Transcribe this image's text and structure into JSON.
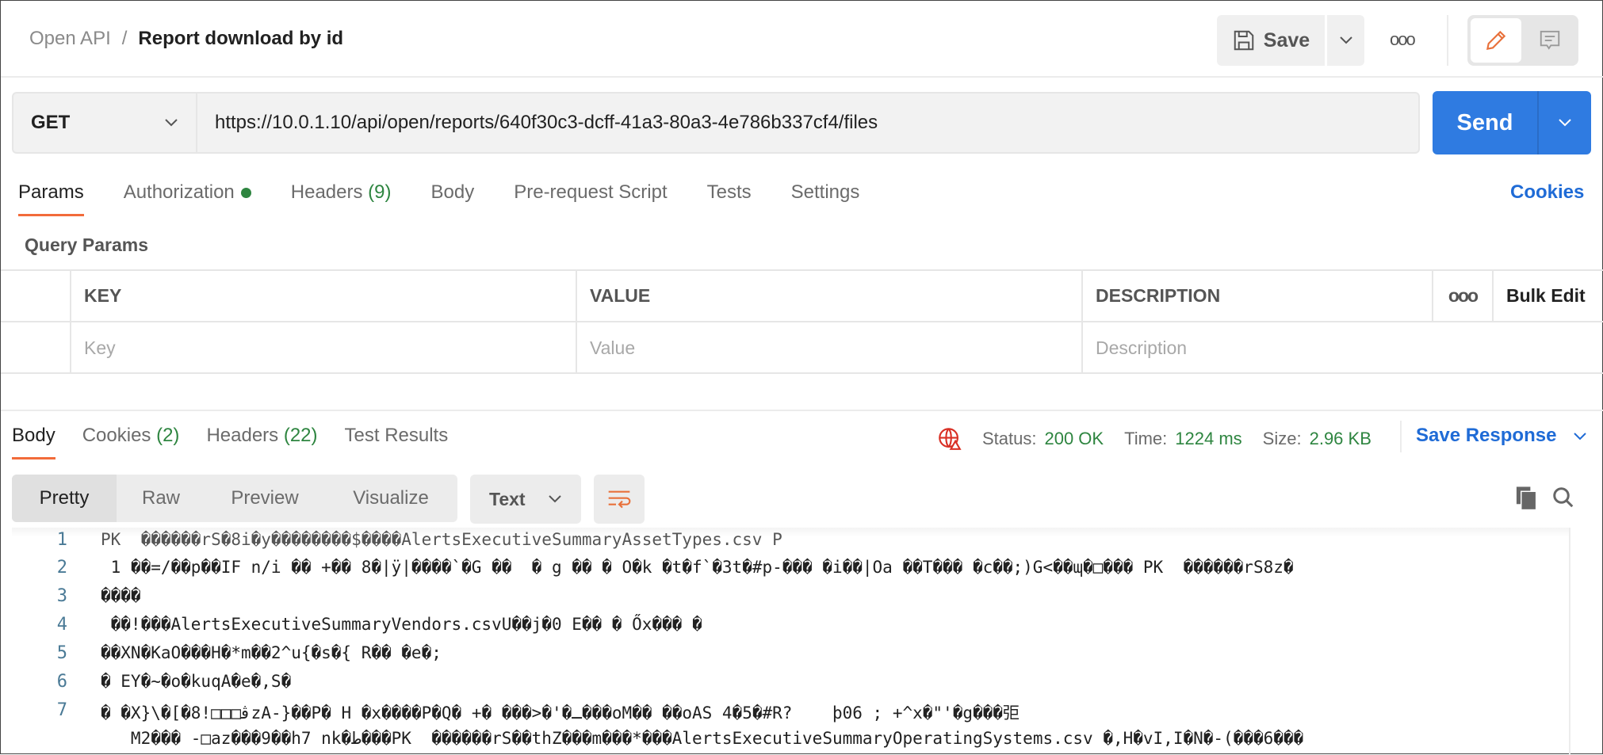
{
  "header": {
    "breadcrumb_parent": "Open API",
    "breadcrumb_sep": "/",
    "title": "Report download by id",
    "save_label": "Save",
    "more": "ooo"
  },
  "request": {
    "method": "GET",
    "url": "https://10.0.1.10/api/open/reports/640f30c3-dcff-41a3-80a3-4e786b337cf4/files",
    "send_label": "Send"
  },
  "tabs": [
    {
      "label": "Params"
    },
    {
      "label": "Authorization"
    },
    {
      "label": "Headers",
      "count": "(9)"
    },
    {
      "label": "Body"
    },
    {
      "label": "Pre-request Script"
    },
    {
      "label": "Tests"
    },
    {
      "label": "Settings"
    }
  ],
  "cookies_link": "Cookies",
  "query_params": {
    "title": "Query Params",
    "columns": [
      "KEY",
      "VALUE",
      "DESCRIPTION"
    ],
    "more": "ooo",
    "bulk_edit": "Bulk Edit",
    "placeholders": {
      "key": "Key",
      "value": "Value",
      "description": "Description"
    }
  },
  "response": {
    "tabs": [
      {
        "label": "Body"
      },
      {
        "label": "Cookies",
        "count": "(2)"
      },
      {
        "label": "Headers",
        "count": "(22)"
      },
      {
        "label": "Test Results"
      }
    ],
    "status_label": "Status:",
    "status": "200 OK",
    "time_label": "Time:",
    "time": "1224 ms",
    "size_label": "Size:",
    "size": "2.96 KB",
    "save_response": "Save Response",
    "views": [
      "Pretty",
      "Raw",
      "Preview",
      "Visualize"
    ],
    "format": "Text",
    "lines": [
      {
        "n": "1",
        "text": "PK  ������rS�8i�y��������$����AlertsExecutiveSummaryAssetTypes.csv P"
      },
      {
        "n": "2",
        "text": " 1 ��=/��p��IF n/i �� +�� 8�|ÿ|����`�G ��  � g �� � O�k �t�f`�3t�#p-��� �i��|Oa ��T��� �c��;)G<��ɰ�□��� PK  ������rS8z�"
      },
      {
        "n": "3",
        "text": "����"
      },
      {
        "n": "4",
        "text": " ��!���AlertsExecutiveSummaryVendors.csvU��j�0 E�� � Őx��� �"
      },
      {
        "n": "5",
        "text": "��XN�KaO���H�*m��2^u{�s�{ R�� �e�;"
      },
      {
        "n": "6",
        "text": "� EY�~�o�kuqA�e�,S�"
      },
      {
        "n": "7",
        "text": "� �X}\\�[�8!□□□ﭬzA-}��P� H �x����P�Q� +� ���>�'�ـ���oM�� ��oAS 4�5�#R?    þ06 ; +^x�\"'�g���弡"
      },
      {
        "n": "",
        "text": "   M2��� -□az���9��h7 nk�ﻁ���PK  ������rS��thZ���m���*���AlertsExecutiveSummaryOperatingSystems.csv �,H�vI,I�N�-(���6���"
      }
    ]
  },
  "colors": {
    "accent": "#f26b3a",
    "primary": "#2f7be1",
    "link": "#1f6bd6",
    "success": "#2e8540",
    "error": "#d93025"
  }
}
